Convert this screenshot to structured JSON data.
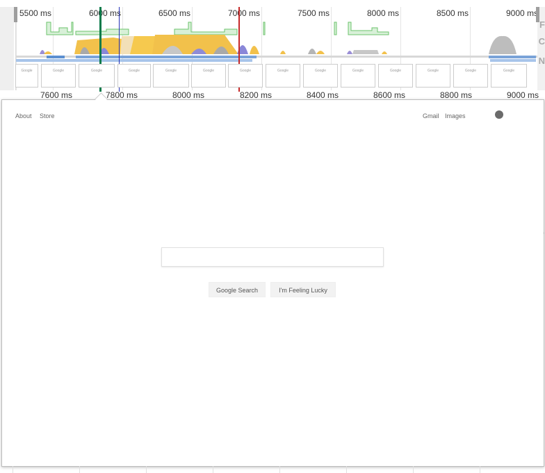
{
  "timeline": {
    "ticks": [
      "5500 ms",
      "6000 ms",
      "6500 ms",
      "7000 ms",
      "7500 ms",
      "8000 ms",
      "8500 ms",
      "9000 ms"
    ],
    "lower_ticks": [
      "7600 ms",
      "7800 ms",
      "8000 ms",
      "8200 ms",
      "8400 ms",
      "8600 ms",
      "8800 ms",
      "9000 ms"
    ],
    "track_labels": [
      "F",
      "C",
      "N"
    ],
    "marker_colors": [
      "#0a7a4a",
      "#2432b8",
      "#c62828"
    ],
    "screenshot_logo": "Google"
  },
  "page": {
    "about": "About",
    "store": "Store",
    "gmail": "Gmail",
    "images": "Images",
    "search_button": "Google Search",
    "lucky_button": "I'm Feeling Lucky",
    "search_value": ""
  }
}
